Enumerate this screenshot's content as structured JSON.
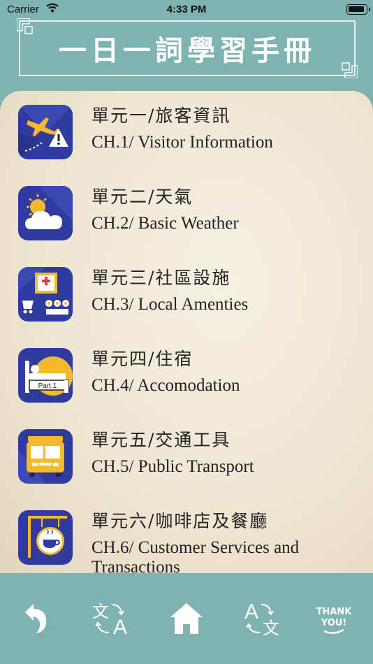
{
  "status": {
    "carrier": "Carrier",
    "time": "4:33 PM"
  },
  "header": {
    "title": "一日一詞學習手冊"
  },
  "units": [
    {
      "zh": "單元一/旅客資訊",
      "en": "CH.1/ Visitor Information",
      "icon": "airplane-alert-icon"
    },
    {
      "zh": "單元二/天氣",
      "en": "CH.2/ Basic Weather",
      "icon": "sun-cloud-icon"
    },
    {
      "zh": "單元三/社區設施",
      "en": "CH.3/ Local Amenties",
      "icon": "community-facilities-icon"
    },
    {
      "zh": "單元四/住宿",
      "en": "CH.4/ Accomodation",
      "icon": "bed-icon",
      "icon_text": "Part 1"
    },
    {
      "zh": "單元五/交通工具",
      "en": "CH.5/ Public Transport",
      "icon": "bus-icon"
    },
    {
      "zh": "單元六/咖啡店及餐廳",
      "en": "CH.6/ Customer Services and Transactions",
      "icon": "cafe-sign-icon"
    }
  ],
  "tabbar": {
    "thank_label": "THANK YOU!",
    "items": [
      "back-icon",
      "translate-zh-en-icon",
      "home-icon",
      "translate-en-zh-icon",
      "thank-you-icon"
    ]
  },
  "colors": {
    "teal": "#7fb3b2",
    "icon_blue": "#2f3c9e",
    "accent_yellow": "#f5b92e",
    "paper": "#f3ecdd"
  }
}
